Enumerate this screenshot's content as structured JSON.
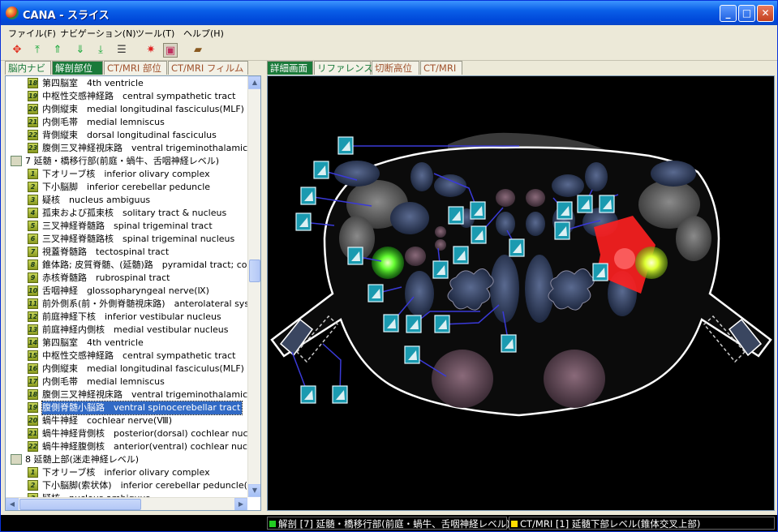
{
  "window": {
    "title": "CANA - スライス"
  },
  "menu": [
    "ファイル(F)",
    "ナビゲーション(N)",
    "ツール(T)",
    "ヘルプ(H)"
  ],
  "toolbar_icons": [
    "go-first-icon",
    "go-top-icon",
    "go-up-icon",
    "go-down-icon",
    "go-bottom-icon",
    "layers-icon",
    "target-icon",
    "slice-view-icon",
    "bag-icon"
  ],
  "left_tabs": [
    {
      "label": "脳内ナビ",
      "active": false
    },
    {
      "label": "解剖部位",
      "active": true
    },
    {
      "label": "CT/MRI 部位",
      "active": false
    },
    {
      "label": "CT/MRI フィルム",
      "active": false
    }
  ],
  "right_tabs": [
    {
      "label": "詳細画面",
      "active": true
    },
    {
      "label": "リファレンス",
      "active": false
    },
    {
      "label": "切断高位",
      "active": false
    },
    {
      "label": "CT/MRI",
      "active": false
    }
  ],
  "tree": [
    {
      "type": "item",
      "num": "18",
      "label": "第四脳室　4th ventricle"
    },
    {
      "type": "item",
      "num": "19",
      "label": "中枢性交感神経路　central sympathetic tract"
    },
    {
      "type": "item",
      "num": "20",
      "label": "内側縦束　medial longitudinal fasciculus(MLF)"
    },
    {
      "type": "item",
      "num": "21",
      "label": "内側毛帯　medial lemniscus"
    },
    {
      "type": "item",
      "num": "22",
      "label": "背側縦束　dorsal longitudinal fasciculus"
    },
    {
      "type": "item",
      "num": "23",
      "label": "腹側三叉神経視床路　ventral trigeminothalamic t"
    },
    {
      "type": "group",
      "label": "7 延髄・橋移行部(前庭・蝸牛、舌咽神経レベル)"
    },
    {
      "type": "item",
      "num": "1",
      "label": "下オリーブ核　inferior olivary complex"
    },
    {
      "type": "item",
      "num": "2",
      "label": "下小脳脚　inferior cerebellar peduncle"
    },
    {
      "type": "item",
      "num": "3",
      "label": "疑核　nucleus ambiguus"
    },
    {
      "type": "item",
      "num": "4",
      "label": "孤束および孤束核　solitary tract & nucleus"
    },
    {
      "type": "item",
      "num": "5",
      "label": "三叉神経脊髄路　spinal trigeminal tract"
    },
    {
      "type": "item",
      "num": "6",
      "label": "三叉神経脊髄路核　spinal trigeminal nucleus"
    },
    {
      "type": "item",
      "num": "7",
      "label": "視蓋脊髄路　tectospinal tract"
    },
    {
      "type": "item",
      "num": "8",
      "label": "錐体路; 皮質脊髄、(延髄)路　pyramidal tract; cor"
    },
    {
      "type": "item",
      "num": "9",
      "label": "赤核脊髄路　rubrospinal tract"
    },
    {
      "type": "item",
      "num": "10",
      "label": "舌咽神経　glossopharyngeal nerve(Ⅸ)"
    },
    {
      "type": "item",
      "num": "11",
      "label": "前外側系(前・外側脊髄視床路)　anterolateral sys"
    },
    {
      "type": "item",
      "num": "12",
      "label": "前庭神経下核　inferior vestibular nucleus"
    },
    {
      "type": "item",
      "num": "13",
      "label": "前庭神経内側核　medial vestibular nucleus"
    },
    {
      "type": "item",
      "num": "14",
      "label": "第四脳室　4th ventricle"
    },
    {
      "type": "item",
      "num": "15",
      "label": "中枢性交感神経路　central sympathetic tract"
    },
    {
      "type": "item",
      "num": "16",
      "label": "内側縦束　medial longitudinal fasciculus(MLF)"
    },
    {
      "type": "item",
      "num": "17",
      "label": "内側毛帯　medial lemniscus"
    },
    {
      "type": "item",
      "num": "18",
      "label": "腹側三叉神経視床路　ventral trigeminothalamic t"
    },
    {
      "type": "item",
      "num": "19",
      "label": "腹側脊髄小脳路　ventral spinocerebellar tract",
      "selected": true
    },
    {
      "type": "item",
      "num": "20",
      "label": "蝸牛神経　cochlear nerve(Ⅷ)"
    },
    {
      "type": "item",
      "num": "21",
      "label": "蝸牛神経背側核　posterior(dorsal) cochlear nucle"
    },
    {
      "type": "item",
      "num": "22",
      "label": "蝸牛神経腹側核　anterior(ventral) cochlear nucle"
    },
    {
      "type": "group",
      "label": "8 延髄上部(迷走神経レベル)"
    },
    {
      "type": "item",
      "num": "1",
      "label": "下オリーブ核　inferior olivary complex"
    },
    {
      "type": "item",
      "num": "2",
      "label": "下小脳脚(索状体)　inferior cerebellar peduncle(r"
    },
    {
      "type": "item",
      "num": "3",
      "label": "疑核　nucleus ambiguus"
    }
  ],
  "status": {
    "left": "解剖 [7] 延髄・橋移行部(前庭・蝸牛、舌咽神経レベル)",
    "right": "CT/MRI [1] 延髄下部レベル(錐体交叉上部)",
    "left_color": "#22cc22",
    "right_color": "#ffdd00"
  },
  "colors": {
    "active_tab": "#1a7a3a",
    "selection": "#316ac5",
    "highlight_red": "#ff2020",
    "highlight_green": "#66ff33"
  }
}
